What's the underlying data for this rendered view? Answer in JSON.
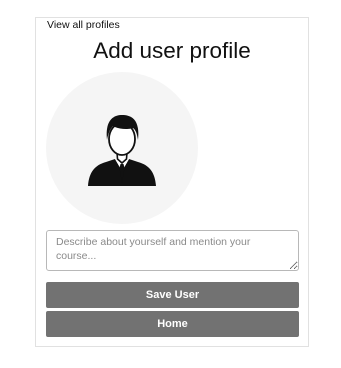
{
  "nav": {
    "back_link": "View all profiles"
  },
  "page": {
    "title": "Add user profile"
  },
  "avatar": {
    "icon": "user-avatar-icon",
    "background": "#f5f5f5"
  },
  "form": {
    "bio_placeholder": "Describe about yourself and mention your course...",
    "bio_value": ""
  },
  "actions": {
    "save_label": "Save User",
    "home_label": "Home",
    "button_color": "#727272"
  }
}
